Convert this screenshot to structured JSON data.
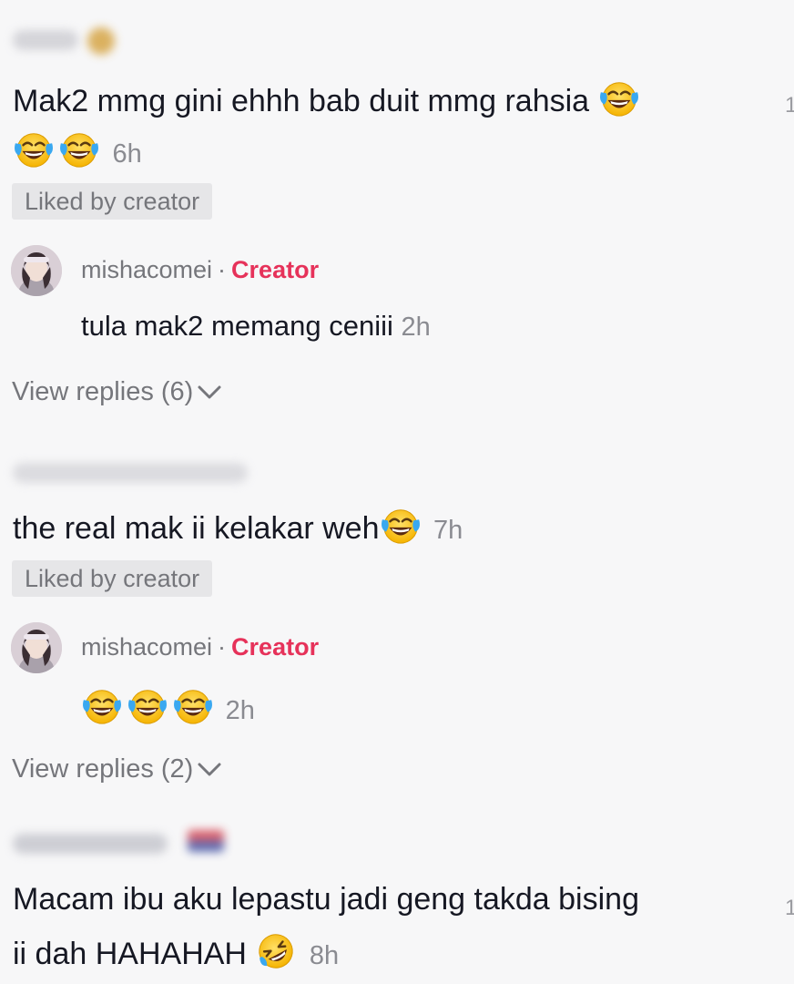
{
  "comments": [
    {
      "text": "Mak2 mmg gini ehhh bab duit mmg rahsia",
      "time": "6h",
      "liked_badge": "Liked by creator",
      "edge_count": "1",
      "emoji_icon": "face-with-tears-of-joy-icon",
      "reply": {
        "username": "mishacomei",
        "separator": "·",
        "creator_tag": "Creator",
        "text": "tula mak2 memang ceniii",
        "time": "2h"
      },
      "view_replies": "View replies (6)"
    },
    {
      "text": "the real mak ii kelakar weh",
      "time": "7h",
      "liked_badge": "Liked by creator",
      "emoji_icon": "face-with-tears-of-joy-icon",
      "reply": {
        "username": "mishacomei",
        "separator": "·",
        "creator_tag": "Creator",
        "text": "",
        "time": "2h"
      },
      "view_replies": "View replies (2)"
    },
    {
      "line1": "Macam ibu aku lepastu jadi geng takda bising",
      "line2": "ii dah HAHAHAH",
      "time": "8h",
      "edge_count": "1",
      "emoji_icon": "rolling-on-floor-laughing-icon"
    }
  ],
  "colors": {
    "background": "#f7f7f8",
    "text": "#161823",
    "secondary_text": "#75767b",
    "creator_tag": "#e6325a",
    "liked_badge_bg": "#e6e6e8"
  }
}
